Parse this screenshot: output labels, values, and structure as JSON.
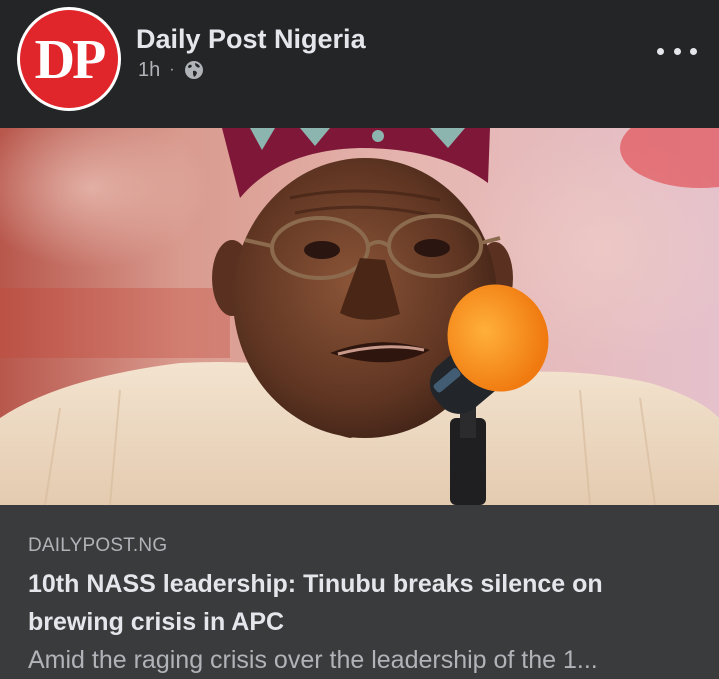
{
  "post": {
    "author": {
      "avatar_text": "DP",
      "name": "Daily Post Nigeria"
    },
    "time": "1h",
    "separator": "·",
    "audience_icon": "globe-icon",
    "more_icon": "more-horizontal-icon",
    "image": {
      "alt": "Photo of a man in a patterned cap and glasses speaking into an orange microphone"
    },
    "link_preview": {
      "domain": "DAILYPOST.NG",
      "title": "10th NASS leadership: Tinubu breaks silence on brewing crisis in APC",
      "description": "Amid the raging crisis over the leadership of the 1..."
    }
  },
  "colors": {
    "background": "#242526",
    "link_preview_background": "#3a3b3c",
    "primary_text": "#e4e6eb",
    "secondary_text": "#b0b3b8",
    "brand_red": "#e0262b"
  }
}
